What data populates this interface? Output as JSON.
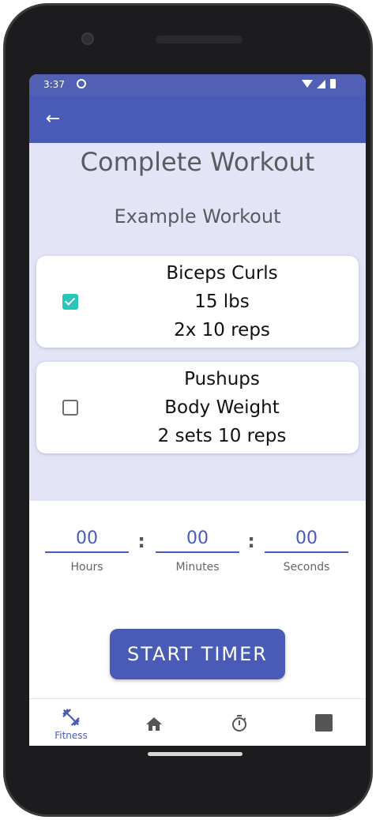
{
  "status_bar": {
    "time": "3:37"
  },
  "page": {
    "title": "Complete Workout",
    "workout_name": "Example Workout"
  },
  "exercises": [
    {
      "name": "Biceps Curls",
      "weight": "15 lbs",
      "detail": "2x 10 reps",
      "checked": true
    },
    {
      "name": "Pushups",
      "weight": "Body Weight",
      "detail": "2 sets 10 reps",
      "checked": false
    }
  ],
  "timer": {
    "hours": {
      "value": "00",
      "label": "Hours"
    },
    "minutes": {
      "value": "00",
      "label": "Minutes"
    },
    "seconds": {
      "value": "00",
      "label": "Seconds"
    },
    "separator": ":",
    "start_label": "START TIMER"
  },
  "bottom_nav": {
    "fitness_label": "Fitness",
    "active": "fitness"
  },
  "colors": {
    "primary": "#4a5bb7",
    "status_bar": "#5160b5",
    "content_bg": "#e3e5f7",
    "check_accent": "#26c6b9"
  },
  "icons": {
    "back": "arrow-left-icon",
    "fitness": "fitness-dumbbell-icon",
    "home": "home-icon",
    "timer": "stopwatch-icon",
    "other": "square-icon"
  }
}
